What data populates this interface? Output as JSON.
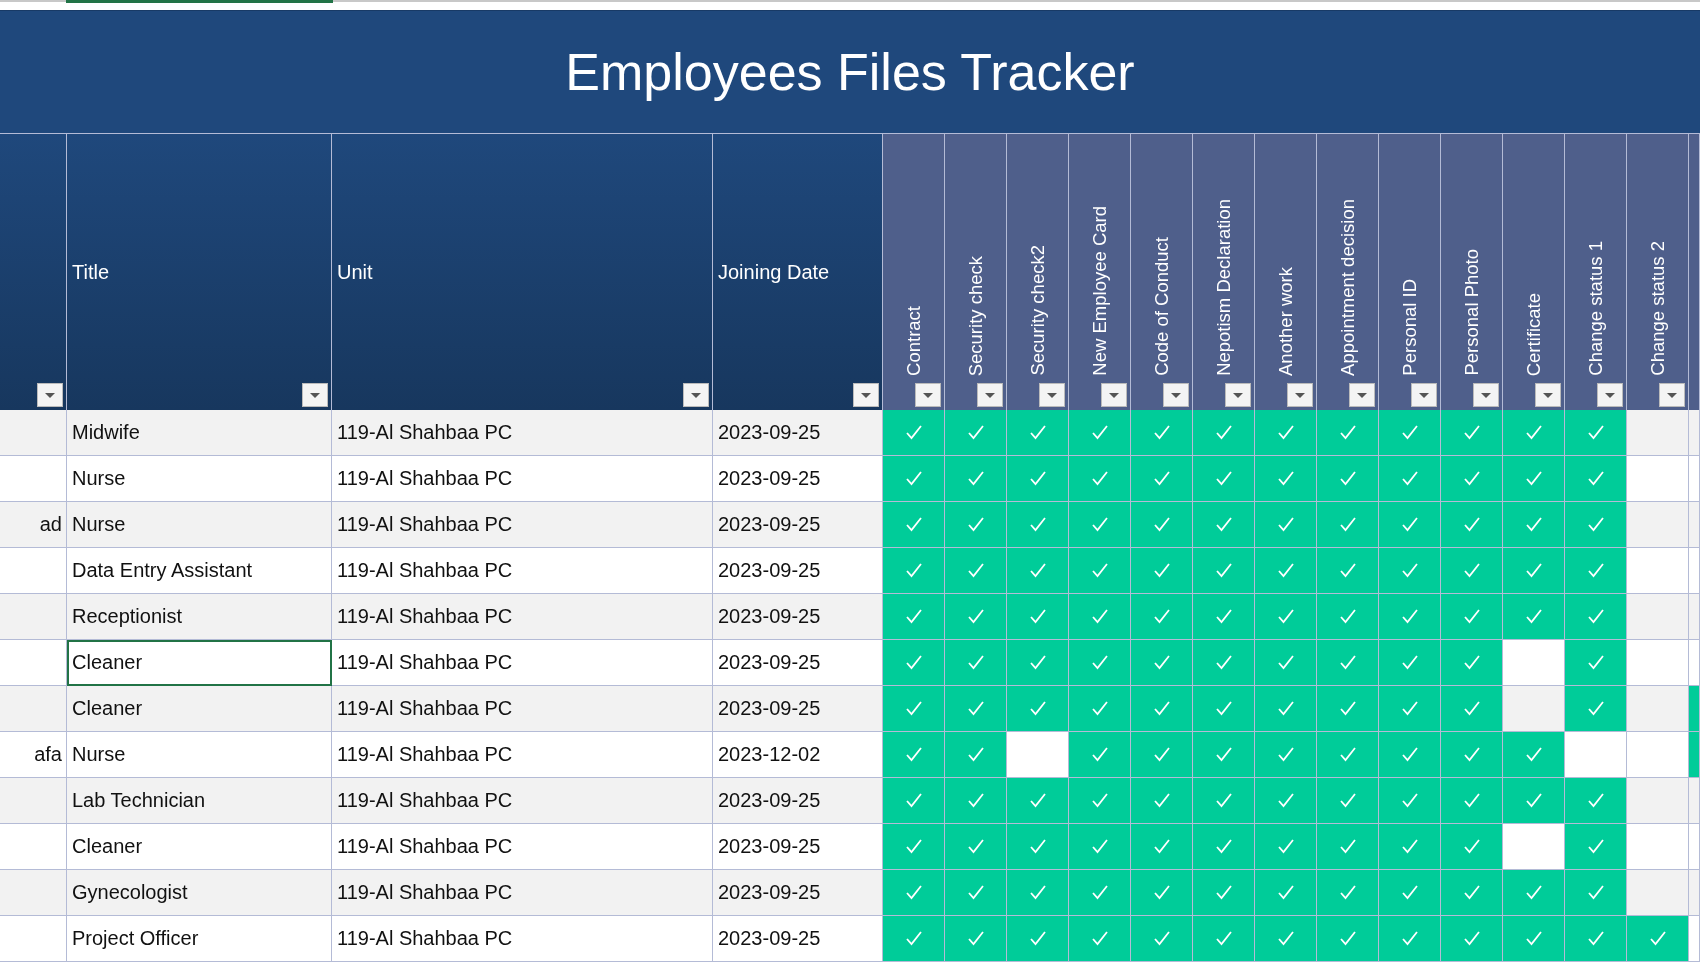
{
  "title": "Employees Files Tracker",
  "columns": [
    "Title",
    "Unit",
    "Joining Date"
  ],
  "check_columns": [
    "Contract",
    "Security check",
    "Security check2",
    "New Employee Card",
    "Code of Conduct",
    "Nepotism Declaration",
    "Another work",
    "Appointment decision",
    "Personal ID",
    "Personal Photo",
    "Certificate",
    "Change status 1",
    "Change status 2"
  ],
  "rows": [
    {
      "title": "Midwife",
      "unit": "119-Al Shahbaa PC",
      "joining_date": "2023-09-25",
      "selected": false,
      "checks": [
        true,
        true,
        true,
        true,
        true,
        true,
        true,
        true,
        true,
        true,
        true,
        true,
        false
      ],
      "column_14_filled": false
    },
    {
      "title": "Nurse",
      "unit": "119-Al Shahbaa PC",
      "joining_date": "2023-09-25",
      "selected": false,
      "checks": [
        true,
        true,
        true,
        true,
        true,
        true,
        true,
        true,
        true,
        true,
        true,
        true,
        false
      ],
      "column_14_filled": false
    },
    {
      "column_1": "ad",
      "title": "Nurse",
      "unit": "119-Al Shahbaa PC",
      "joining_date": "2023-09-25",
      "selected": false,
      "checks": [
        true,
        true,
        true,
        true,
        true,
        true,
        true,
        true,
        true,
        true,
        true,
        true,
        false
      ],
      "column_14_filled": false
    },
    {
      "title": "Data Entry Assistant",
      "unit": "119-Al Shahbaa PC",
      "joining_date": "2023-09-25",
      "selected": false,
      "checks": [
        true,
        true,
        true,
        true,
        true,
        true,
        true,
        true,
        true,
        true,
        true,
        true,
        false
      ],
      "column_14_filled": false
    },
    {
      "title": "Receptionist",
      "unit": "119-Al Shahbaa PC",
      "joining_date": "2023-09-25",
      "selected": false,
      "checks": [
        true,
        true,
        true,
        true,
        true,
        true,
        true,
        true,
        true,
        true,
        true,
        true,
        false
      ],
      "column_14_filled": false
    },
    {
      "title": "Cleaner",
      "unit": "119-Al Shahbaa PC",
      "joining_date": "2023-09-25",
      "selected": true,
      "checks": [
        true,
        true,
        true,
        true,
        true,
        true,
        true,
        true,
        true,
        true,
        false,
        true,
        false
      ],
      "column_14_filled": false
    },
    {
      "title": "Cleaner",
      "unit": "119-Al Shahbaa PC",
      "joining_date": "2023-09-25",
      "selected": false,
      "checks": [
        true,
        true,
        true,
        true,
        true,
        true,
        true,
        true,
        true,
        true,
        false,
        true,
        false
      ],
      "column_14_filled": true
    },
    {
      "column_1": "afa",
      "title": "Nurse",
      "unit": "119-Al Shahbaa PC",
      "joining_date": "2023-12-02",
      "selected": false,
      "checks": [
        true,
        true,
        false,
        true,
        true,
        true,
        true,
        true,
        true,
        true,
        true,
        false,
        false
      ],
      "column_14_filled": true
    },
    {
      "title": "Lab Technician",
      "unit": "119-Al Shahbaa PC",
      "joining_date": "2023-09-25",
      "selected": false,
      "checks": [
        true,
        true,
        true,
        true,
        true,
        true,
        true,
        true,
        true,
        true,
        true,
        true,
        false
      ],
      "column_14_filled": false
    },
    {
      "title": "Cleaner",
      "unit": "119-Al Shahbaa PC",
      "joining_date": "2023-09-25",
      "selected": false,
      "checks": [
        true,
        true,
        true,
        true,
        true,
        true,
        true,
        true,
        true,
        true,
        false,
        true,
        false
      ],
      "column_14_filled": false
    },
    {
      "title": "Gynecologist",
      "unit": "119-Al Shahbaa PC",
      "joining_date": "2023-09-25",
      "selected": false,
      "checks": [
        true,
        true,
        true,
        true,
        true,
        true,
        true,
        true,
        true,
        true,
        true,
        true,
        false
      ],
      "column_14_filled": false
    },
    {
      "title": "Project Officer",
      "unit": "119-Al Shahbaa PC",
      "joining_date": "2023-09-25",
      "selected": false,
      "checks": [
        true,
        true,
        true,
        true,
        true,
        true,
        true,
        true,
        true,
        true,
        true,
        true,
        true
      ],
      "column_14_filled": false
    }
  ]
}
